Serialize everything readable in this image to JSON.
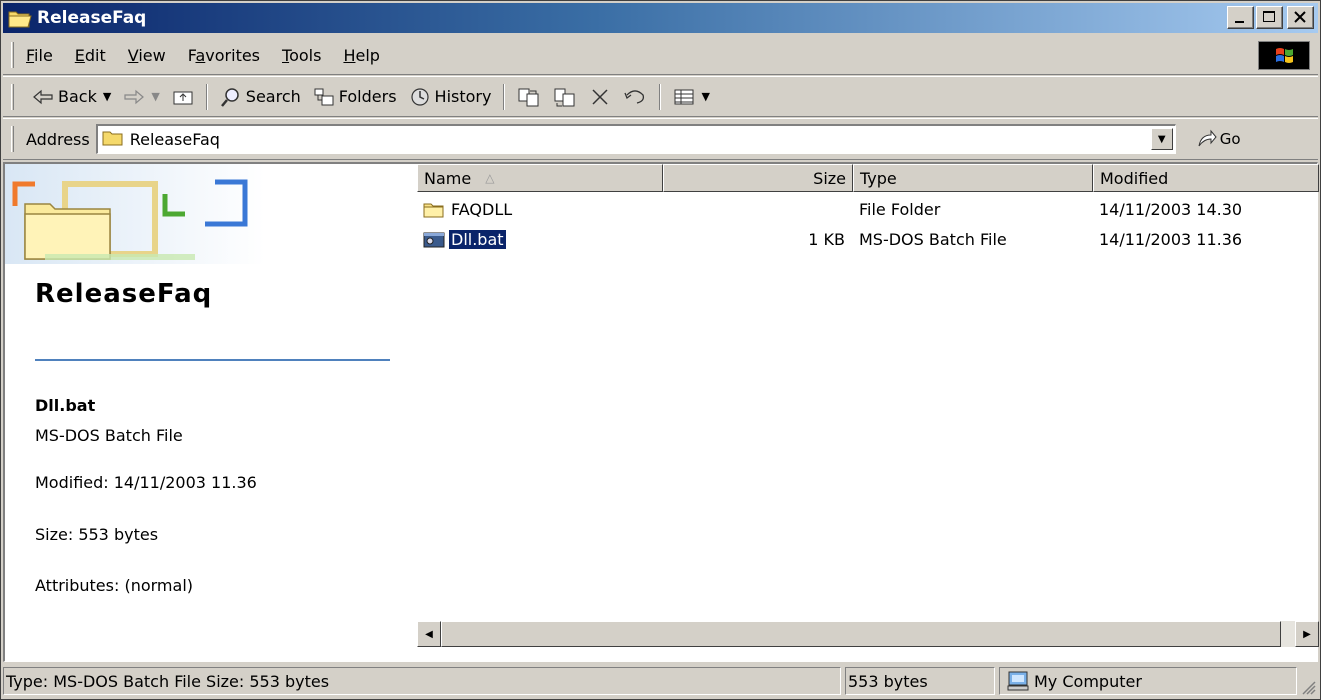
{
  "window": {
    "title": "ReleaseFaq",
    "controls": [
      "minimize",
      "maximize",
      "close"
    ]
  },
  "menu": {
    "items": [
      {
        "label": "File",
        "accel": "F"
      },
      {
        "label": "Edit",
        "accel": "E"
      },
      {
        "label": "View",
        "accel": "V"
      },
      {
        "label": "Favorites",
        "accel": "a"
      },
      {
        "label": "Tools",
        "accel": "T"
      },
      {
        "label": "Help",
        "accel": "H"
      }
    ]
  },
  "toolbar": {
    "back_label": "Back",
    "search_label": "Search",
    "folders_label": "Folders",
    "history_label": "History",
    "icons": [
      "back-arrow-icon",
      "forward-arrow-icon",
      "up-folder-icon",
      "search-icon",
      "folders-icon",
      "history-icon",
      "move-to-icon",
      "copy-to-icon",
      "delete-icon",
      "undo-icon",
      "views-icon"
    ]
  },
  "address": {
    "label": "Address",
    "value": "ReleaseFaq",
    "go_label": "Go"
  },
  "left_pane": {
    "folder_title": "ReleaseFaq",
    "selected_name": "Dll.bat",
    "selected_type": "MS-DOS Batch File",
    "modified": "Modified: 14/11/2003 11.36",
    "size": "Size: 553 bytes",
    "attributes": "Attributes: (normal)"
  },
  "list": {
    "columns": {
      "name": "Name",
      "size": "Size",
      "type": "Type",
      "modified": "Modified"
    },
    "sort_indicator": "△",
    "rows": [
      {
        "name": "FAQDLL",
        "size": "",
        "type": "File Folder",
        "modified": "14/11/2003 14.30",
        "icon": "folder-icon",
        "selected": false
      },
      {
        "name": "Dll.bat",
        "size": "1 KB",
        "type": "MS-DOS Batch File",
        "modified": "14/11/2003 11.36",
        "icon": "batch-file-icon",
        "selected": true
      }
    ]
  },
  "status": {
    "main": "Type: MS-DOS Batch File Size: 553 bytes",
    "size": "553 bytes",
    "zone": "My Computer"
  },
  "colors": {
    "title_gradient_start": "#0a246a",
    "title_gradient_end": "#a6caf0",
    "selection": "#0a246a",
    "face": "#d4d0c8",
    "banner_line": "#4f81bd"
  }
}
